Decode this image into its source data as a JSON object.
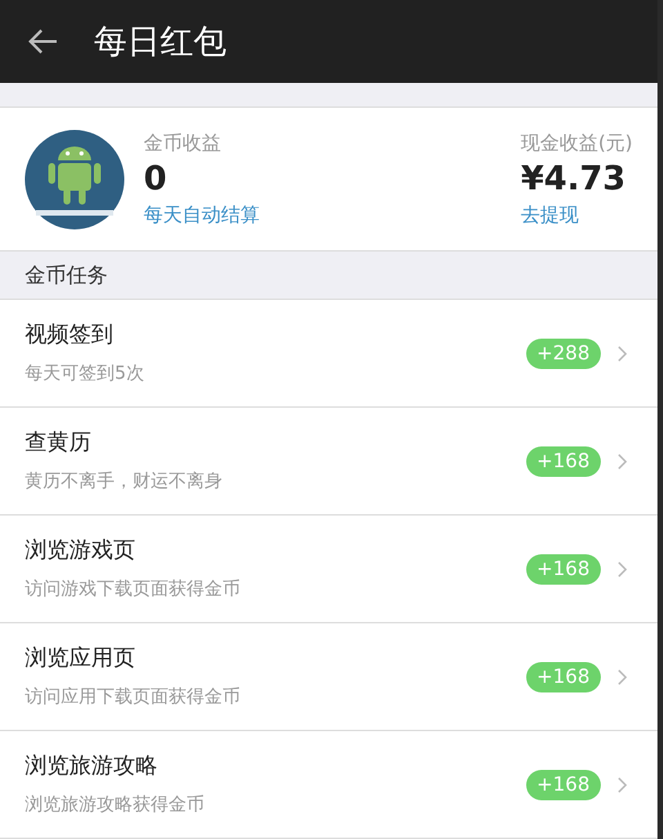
{
  "header": {
    "title": "每日红包"
  },
  "earnings": {
    "coin_label": "金币收益",
    "coin_value": "0",
    "coin_note": "每天自动结算",
    "cash_label": "现金收益(元)",
    "cash_value": "¥4.73",
    "cash_link": "去提现"
  },
  "section": {
    "title": "金币任务"
  },
  "tasks": [
    {
      "title": "视频签到",
      "subtitle": "每天可签到5次",
      "reward": "+288"
    },
    {
      "title": "查黄历",
      "subtitle": "黄历不离手，财运不离身",
      "reward": "+168"
    },
    {
      "title": "浏览游戏页",
      "subtitle": "访问游戏下载页面获得金币",
      "reward": "+168"
    },
    {
      "title": "浏览应用页",
      "subtitle": "访问应用下载页面获得金币",
      "reward": "+168"
    },
    {
      "title": "浏览旅游攻略",
      "subtitle": "浏览旅游攻略获得金币",
      "reward": "+168"
    }
  ]
}
